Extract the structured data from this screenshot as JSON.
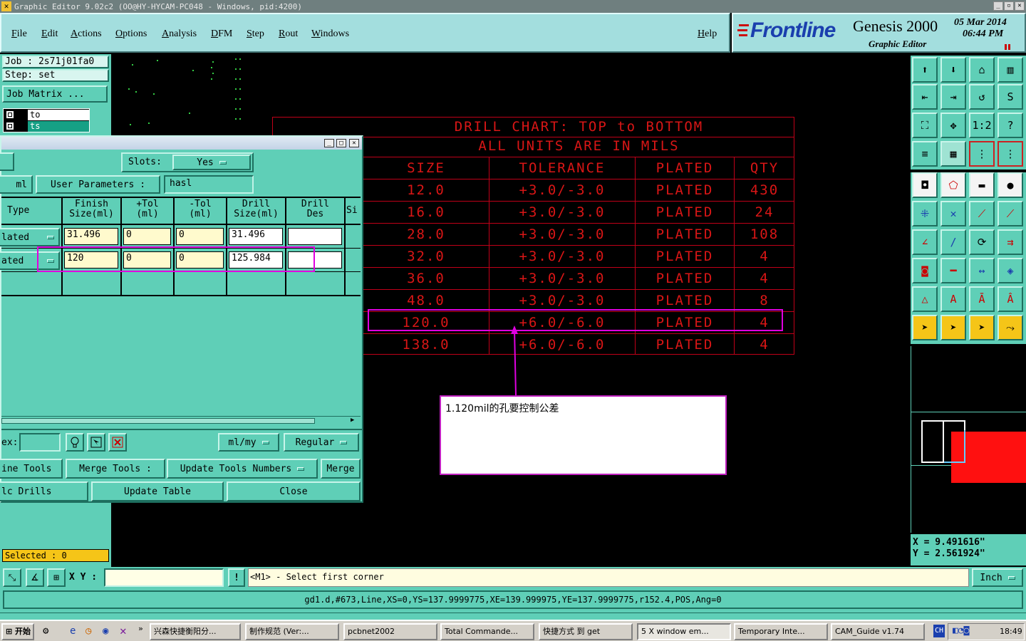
{
  "window": {
    "title": "Graphic Editor 9.02c2  (OO@HY-HYCAM-PC048 - Windows, pid:4200)"
  },
  "menu": {
    "items": [
      "File",
      "Edit",
      "Actions",
      "Options",
      "Analysis",
      "DFM",
      "Step",
      "Rout",
      "Windows"
    ],
    "help": "Help"
  },
  "brand": {
    "logo": "Frontline",
    "product": "Genesis 2000",
    "subtitle": "Graphic Editor",
    "date": "05 Mar 2014",
    "time": "06:44 PM"
  },
  "left_panel": {
    "job_label": "Job : 2s71j01fa0",
    "step_label": "Step: set",
    "job_matrix": "Job Matrix ...",
    "layers": [
      "to",
      "ts"
    ],
    "selected": "Selected : 0"
  },
  "dialog": {
    "slots_label": "Slots:",
    "slots_value": "Yes",
    "units_value": "ml",
    "user_params": "User Parameters :",
    "user_params_value": "hasl",
    "columns": [
      "Type",
      "Finish\nSize(ml)",
      "+Tol\n(ml)",
      "-Tol\n(ml)",
      "Drill\nSize(ml)",
      "Drill\nDes",
      "Si"
    ],
    "rows": [
      {
        "type": "lated",
        "finish": "31.496",
        "ptol": "0",
        "ntol": "0",
        "drill": "31.496",
        "des": ""
      },
      {
        "type": "ated",
        "finish": "120",
        "ptol": "0",
        "ntol": "0",
        "drill": "125.984",
        "des": ""
      }
    ],
    "index_label": "ex:",
    "units_dropdown": "ml/my",
    "mode_dropdown": "Regular",
    "buttons_row1": [
      "ine Tools",
      "Merge Tools :",
      "Update Tools Numbers",
      "Merge"
    ],
    "buttons_row2": [
      "lc Drills",
      "Update Table",
      "Close"
    ]
  },
  "chart": {
    "title1": "DRILL CHART: TOP to BOTTOM",
    "title2": "ALL UNITS ARE IN MILS",
    "headers": [
      "SIZE",
      "TOLERANCE",
      "PLATED",
      "QTY"
    ],
    "rows": [
      [
        "12.0",
        "+3.0/-3.0",
        "PLATED",
        "430"
      ],
      [
        "16.0",
        "+3.0/-3.0",
        "PLATED",
        "24"
      ],
      [
        "28.0",
        "+3.0/-3.0",
        "PLATED",
        "108"
      ],
      [
        "32.0",
        "+3.0/-3.0",
        "PLATED",
        "4"
      ],
      [
        "36.0",
        "+3.0/-3.0",
        "PLATED",
        "4"
      ],
      [
        "48.0",
        "+3.0/-3.0",
        "PLATED",
        "8"
      ],
      [
        "120.0",
        "+6.0/-6.0",
        "PLATED",
        "4"
      ],
      [
        "138.0",
        "+6.0/-6.0",
        "PLATED",
        "4"
      ]
    ]
  },
  "annotation": {
    "note": "1.120mil的孔要控制公差"
  },
  "coords": {
    "x": "X = 9.491616\"",
    "y": "Y = 2.561924\""
  },
  "status": {
    "xy_label": "X Y :",
    "prompt": "<M1> - Select first corner",
    "units": "Inch",
    "info": "gd1.d,#673,Line,XS=0,YS=137.9999775,XE=139.999975,YE=137.9999775,r152.4,POS,Ang=0"
  },
  "taskbar": {
    "start": "开始",
    "tasks": [
      "兴森快捷衡阳分...",
      "制作规范 (Ver:...",
      "pcbnet2002",
      "Total Commande...",
      "快捷方式 到 get",
      "5 X window em...",
      "Temporary Inte...",
      "CAM_Guide v1.74"
    ],
    "clock": "18:49",
    "lang": "CH"
  },
  "colors": {
    "panel": "#5fcfb7",
    "chart_text": "#ff1a1a",
    "highlight": "#e000e0",
    "menu": "#a3dede"
  }
}
